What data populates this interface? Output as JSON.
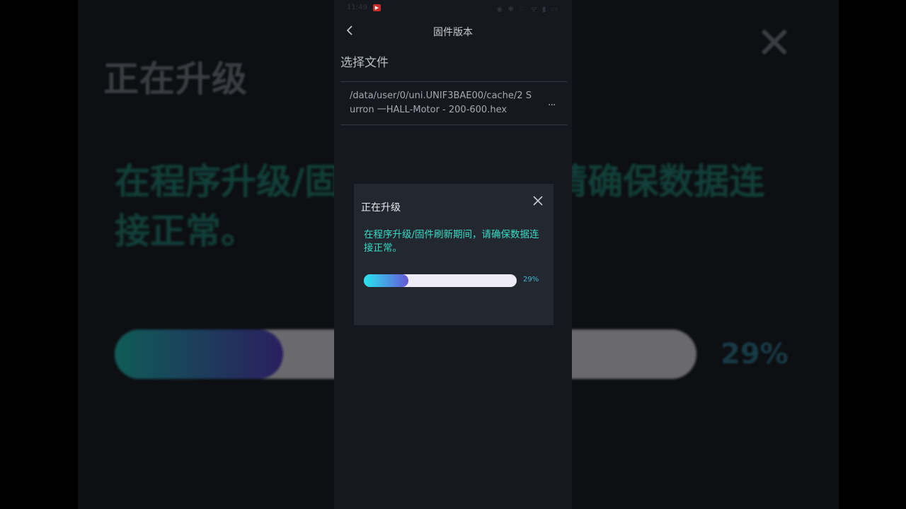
{
  "status_bar": {
    "time": "11:49",
    "icons": "◉ ✱ ⌔ ᯤ ▮ ▭"
  },
  "header": {
    "title": "固件版本"
  },
  "file_section": {
    "title": "选择文件",
    "path": "/data/user/0/uni.UNIF3BAE00/cache/2 Surron 一HALL-Motor - 200-600.hex",
    "more_label": "···"
  },
  "dialog": {
    "title": "正在升级",
    "message": "在程序升级/固件刷新期间，请确保数据连接正常。",
    "progress_percent": 29,
    "progress_label": "29%"
  },
  "colors": {
    "accent_text": "#37dcc6",
    "progress_start": "#27e6ee",
    "progress_end": "#6856d7",
    "dialog_bg": "#232730",
    "screen_bg": "#15191f"
  }
}
